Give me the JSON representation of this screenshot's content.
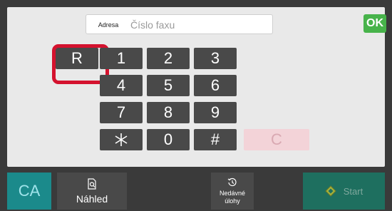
{
  "colors": {
    "accent_ok": "#47b34a",
    "key_bg": "#494949",
    "highlight": "#d4122e",
    "ca_bg": "#1b8a8b",
    "start_bg": "#1e6f5f"
  },
  "input": {
    "tag_label": "Adresa",
    "placeholder": "Číslo faxu",
    "value": ""
  },
  "ok_label": "OK",
  "keypad": {
    "r_key": "R",
    "digits": [
      "1",
      "2",
      "3",
      "4",
      "5",
      "6",
      "7",
      "8",
      "9"
    ],
    "star": "∗",
    "zero": "0",
    "hash": "#",
    "clear": "C"
  },
  "toolbar": {
    "ca_label": "CA",
    "preview_label": "Náhled",
    "recent_label_line1": "Nedávné",
    "recent_label_line2": "úlohy",
    "start_label": "Start",
    "preview_icon": "preview-icon",
    "recent_icon": "history-icon",
    "start_icon": "start-diamond-icon"
  }
}
